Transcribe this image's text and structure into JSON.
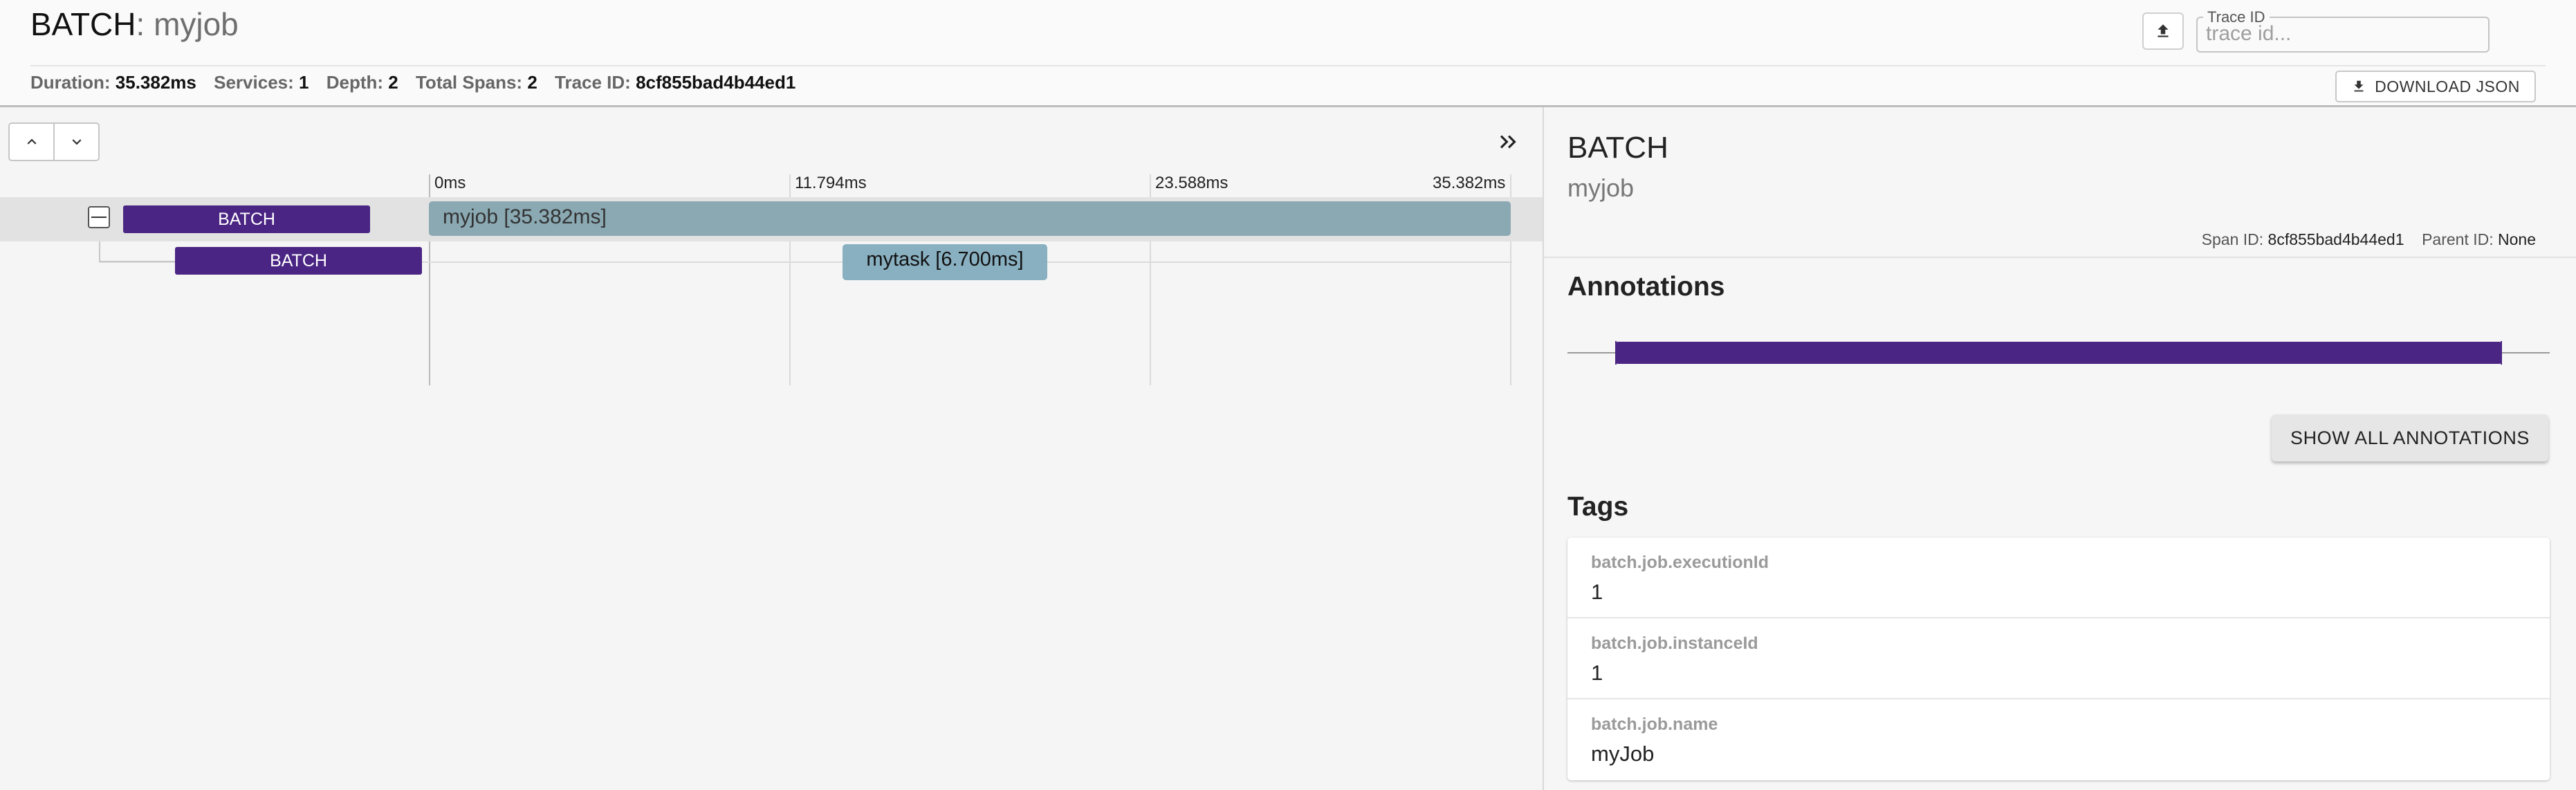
{
  "header": {
    "service": "BATCH",
    "separator": ": ",
    "span_name": "myjob",
    "trace_id_label": "Trace ID",
    "trace_id_placeholder": "trace id...",
    "download_label": "DOWNLOAD JSON",
    "stats": {
      "duration_label": "Duration:",
      "duration": "35.382ms",
      "services_label": "Services:",
      "services": "1",
      "depth_label": "Depth:",
      "depth": "2",
      "total_spans_label": "Total Spans:",
      "total_spans": "2",
      "trace_id_label": "Trace ID:",
      "trace_id": "8cf855bad4b44ed1"
    }
  },
  "timeline": {
    "ticks": [
      "0ms",
      "11.794ms",
      "23.588ms",
      "35.382ms"
    ],
    "spans": [
      {
        "service": "BATCH",
        "label": "myjob [35.382ms]"
      },
      {
        "service": "BATCH",
        "label": "mytask [6.700ms]"
      }
    ]
  },
  "detail": {
    "service": "BATCH",
    "span_name": "myjob",
    "span_id_label": "Span ID:",
    "span_id": "8cf855bad4b44ed1",
    "parent_id_label": "Parent ID:",
    "parent_id": "None",
    "annotations_title": "Annotations",
    "show_all_label": "SHOW ALL ANNOTATIONS",
    "tags_title": "Tags",
    "tags": [
      {
        "key": "batch.job.executionId",
        "value": "1"
      },
      {
        "key": "batch.job.instanceId",
        "value": "1"
      },
      {
        "key": "batch.job.name",
        "value": "myJob"
      }
    ]
  },
  "colors": {
    "service_tag": "#4a2583",
    "span_bar": "#8aa9b3",
    "child_span_bar": "#89b0c1"
  },
  "icons": [
    "upload-icon",
    "download-icon",
    "chevron-up-icon",
    "chevron-down-icon",
    "double-chevron-right-icon",
    "collapse-icon"
  ]
}
